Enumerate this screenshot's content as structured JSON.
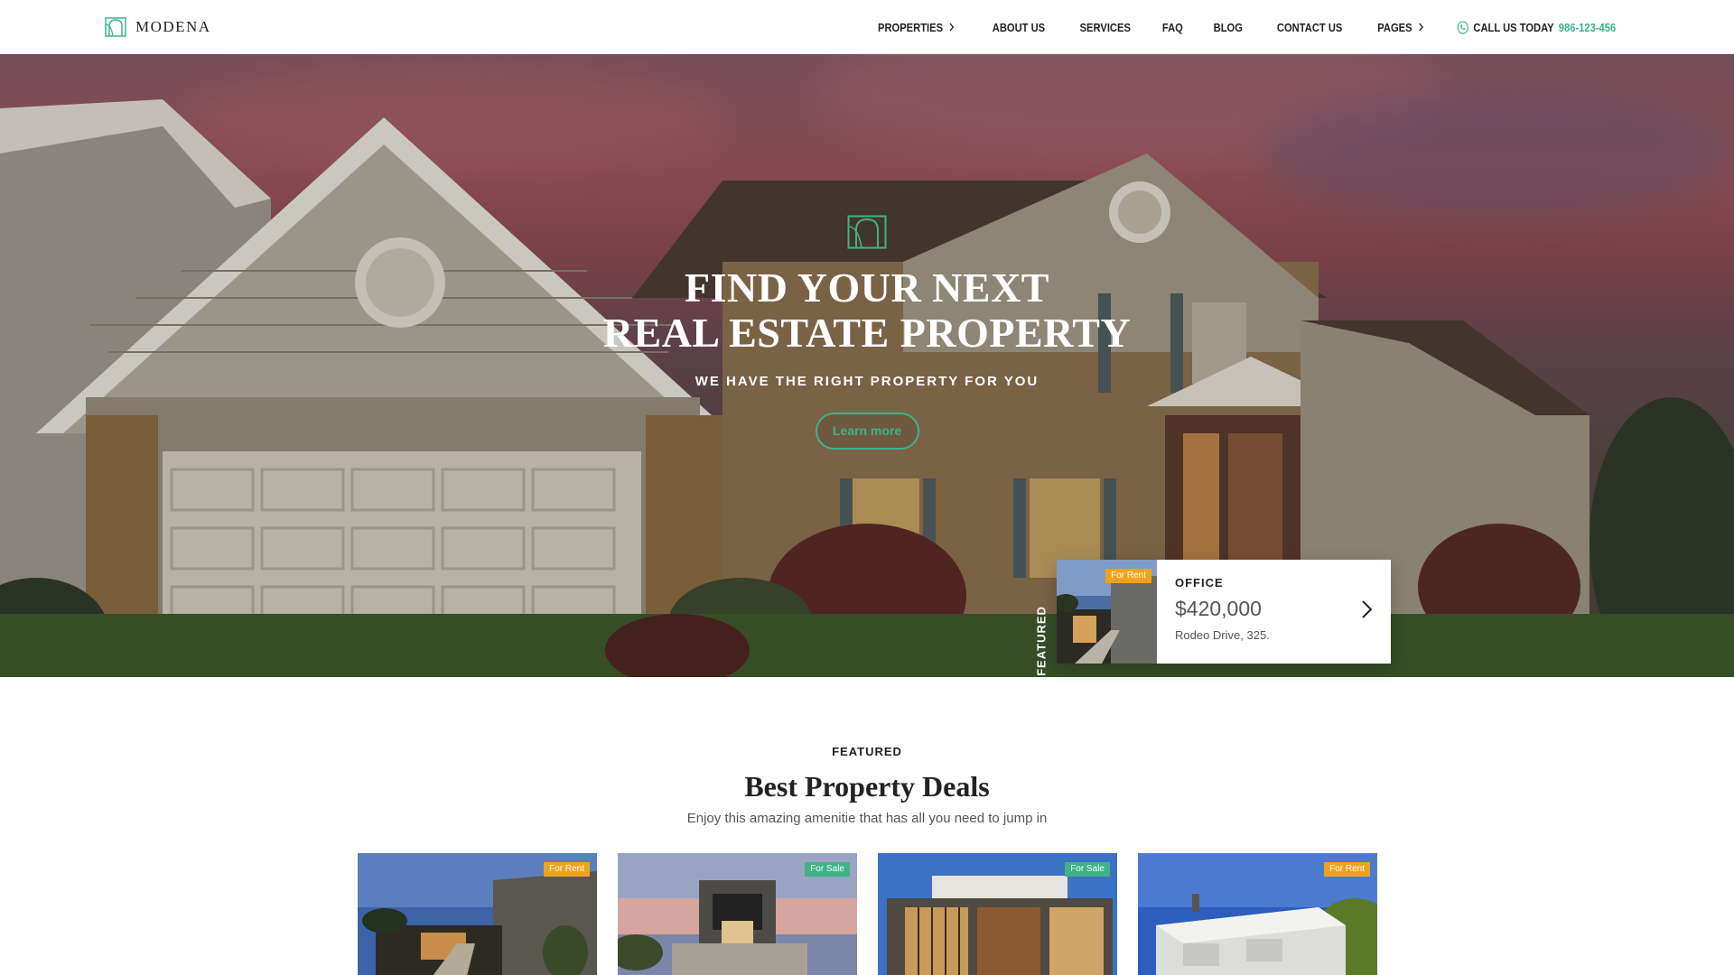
{
  "brand": {
    "name": "MODENA"
  },
  "nav": {
    "items": [
      {
        "label": "PROPERTIES",
        "dropdown": true
      },
      {
        "label": "ABOUT US",
        "dropdown": false
      },
      {
        "label": "SERVICES",
        "dropdown": false
      },
      {
        "label": "FAQ",
        "dropdown": false
      },
      {
        "label": "BLOG",
        "dropdown": false
      },
      {
        "label": "CONTACT US",
        "dropdown": false
      },
      {
        "label": "PAGES",
        "dropdown": true
      }
    ],
    "call_label": "CALL US TODAY",
    "call_phone": "986-123-456"
  },
  "hero": {
    "title_line1": "FIND YOUR NEXT",
    "title_line2": "REAL ESTATE PROPERTY",
    "subtitle": "WE HAVE THE RIGHT PROPERTY FOR YOU",
    "cta_label": "Learn more"
  },
  "featured_card": {
    "side_label": "FEATURED",
    "badge": "For Rent",
    "type": "OFFICE",
    "price": "$420,000",
    "address": "Rodeo Drive, 325."
  },
  "section": {
    "eyebrow": "FEATURED",
    "title": "Best Property Deals",
    "subtitle": "Enjoy this amazing amenitie that has all you need to jump in"
  },
  "property_cards": [
    {
      "badge": "For Rent",
      "status": "rent"
    },
    {
      "badge": "For Sale",
      "status": "sale"
    },
    {
      "badge": "For Sale",
      "status": "sale"
    },
    {
      "badge": "For Rent",
      "status": "rent"
    }
  ],
  "colors": {
    "accent": "#3db387",
    "rent_badge": "#f0a21c",
    "sale_badge": "#3db387"
  },
  "icons": {
    "brand": "arch-logo-icon",
    "dropdown": "chevron-right-icon",
    "phone": "phone-icon",
    "card_next": "chevron-right-icon"
  }
}
